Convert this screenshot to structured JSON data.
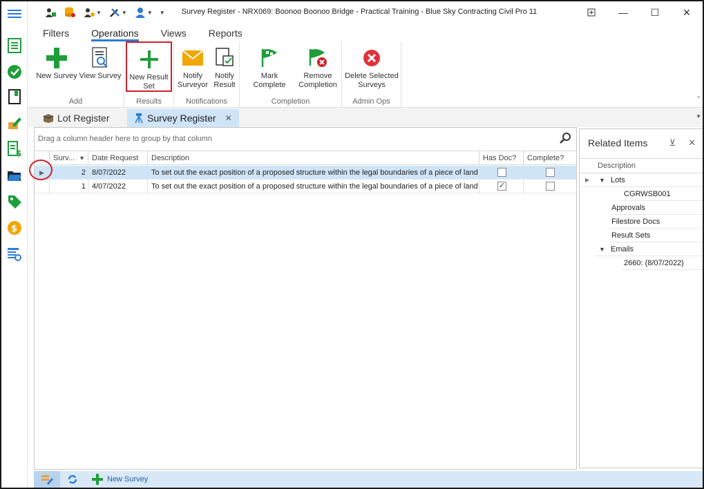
{
  "window": {
    "title": "Survey Register - NRX069: Boonoo Boonoo Bridge - Practical Training - Blue Sky Contracting Civil Pro 11",
    "controls": [
      "pin-icon",
      "minimize-icon",
      "maximize-icon",
      "close-icon"
    ]
  },
  "ribbon": {
    "tabs": [
      {
        "label": "Filters"
      },
      {
        "label": "Operations"
      },
      {
        "label": "Views"
      },
      {
        "label": "Reports"
      }
    ],
    "active_tab": "Operations",
    "groups": {
      "add": {
        "label": "Add",
        "new_survey": "New Survey",
        "view_survey": "View Survey"
      },
      "results": {
        "label": "Results",
        "new_result_set_line1": "New Result",
        "new_result_set_line2": "Set"
      },
      "notifications": {
        "label": "Notifications",
        "notify_surveyor_line1": "Notify",
        "notify_surveyor_line2": "Surveyor",
        "notify_result_line1": "Notify",
        "notify_result_line2": "Result"
      },
      "completion": {
        "label": "Completion",
        "mark_complete": "Mark Complete",
        "remove_completion_line1": "Remove",
        "remove_completion_line2": "Completion"
      },
      "admin_ops": {
        "label": "Admin Ops",
        "delete_selected_line1": "Delete Selected",
        "delete_selected_line2": "Surveys"
      }
    }
  },
  "doc_tabs": [
    {
      "label": "Lot Register",
      "active": false
    },
    {
      "label": "Survey Register",
      "active": true
    }
  ],
  "grid": {
    "group_hint": "Drag a column header here to group by that column",
    "columns": {
      "surv": "Surv...",
      "date_request": "Date Request",
      "description": "Description",
      "has_doc": "Has Doc?",
      "complete": "Complete?"
    },
    "rows": [
      {
        "surv": "2",
        "date_request": "8/07/2022",
        "description": "To set out the exact position of a proposed structure within the legal boundaries of a piece of land",
        "has_doc": false,
        "complete": false,
        "selected": true
      },
      {
        "surv": "1",
        "date_request": "4/07/2022",
        "description": "To set out the exact position of a proposed structure within the legal boundaries of a piece of land",
        "has_doc": true,
        "complete": false,
        "selected": false
      }
    ]
  },
  "related": {
    "title": "Related Items",
    "column": "Description",
    "items": {
      "lots": "Lots",
      "lot_child": "CGRWSB001",
      "approvals": "Approvals",
      "filestore": "Filestore Docs",
      "result_sets": "Result Sets",
      "emails": "Emails",
      "email_child": "2660: (8/07/2022)"
    }
  },
  "bottom_bar": {
    "new_survey": "New Survey"
  },
  "colors": {
    "accent": "#2b7cd3",
    "selection": "#cfe4f7",
    "highlight_red": "#d0202a",
    "green": "#1e9e3a"
  }
}
